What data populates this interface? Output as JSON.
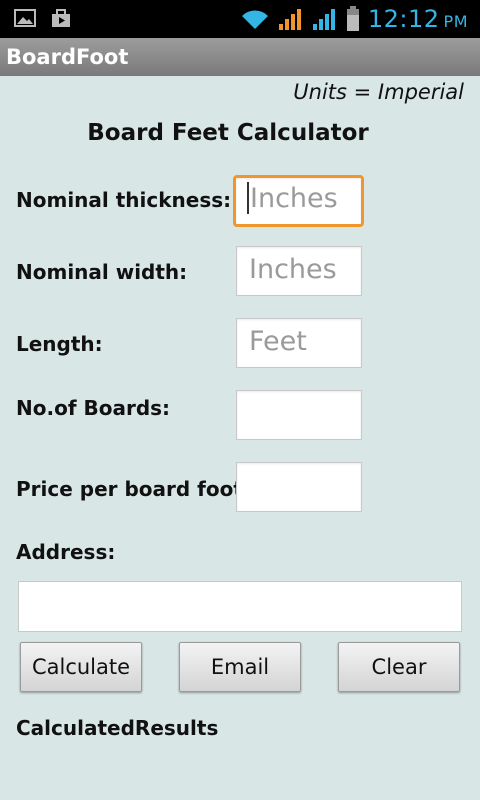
{
  "status_bar": {
    "time": "12:12",
    "ampm": "PM",
    "icons": [
      "image-icon",
      "briefcase-icon",
      "wifi-icon",
      "signal-icon",
      "signal-icon-2",
      "battery-icon"
    ],
    "accent_color": "#33b5e5"
  },
  "app": {
    "title": "BoardFoot"
  },
  "units_label": "Units = Imperial",
  "heading": "Board Feet Calculator",
  "fields": [
    {
      "label": "Nominal thickness:",
      "placeholder": "Inches",
      "value": "",
      "focused": true
    },
    {
      "label": "Nominal width:",
      "placeholder": "Inches",
      "value": ""
    },
    {
      "label": "Length:",
      "placeholder": "Feet",
      "value": ""
    },
    {
      "label": "No.of Boards:",
      "placeholder": "",
      "value": ""
    },
    {
      "label": "Price per board foot:",
      "placeholder": "",
      "value": ""
    }
  ],
  "address": {
    "label": "Address:",
    "value": ""
  },
  "buttons": {
    "calculate": "Calculate",
    "email": "Email",
    "clear": "Clear"
  },
  "results_label": "CalculatedResults",
  "colors": {
    "background": "#d9e6e6",
    "focus_border": "#f0962c"
  }
}
